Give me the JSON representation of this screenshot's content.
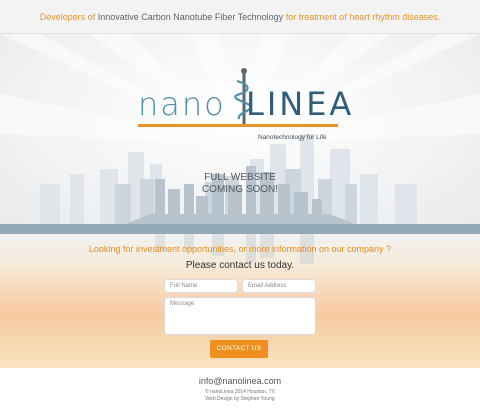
{
  "tagline": {
    "part1": "Developers of ",
    "part2": "Innovative Carbon Nanotube Fiber Technology",
    "part3": " for treatment of heart rhythm  diseases."
  },
  "logo": {
    "nano": "nano",
    "linea": "LINEA",
    "subtitle": "Nanotechnology for Life"
  },
  "hero": {
    "coming_line1": "FULL WEBSITE",
    "coming_line2": "COMING SOON!"
  },
  "contact": {
    "question": "Looking for  investment opportunities, or more information on our company ?",
    "prompt": "Please contact us today.",
    "full_name_placeholder": "Full Name",
    "email_placeholder": "Email Address",
    "message_placeholder": "Message",
    "button_label": "CONTACT US"
  },
  "footer": {
    "email": "info@nanolinea.com",
    "copyright": "© nanoLinea 2014 Houston, TX",
    "credit": "Web Design by Stephen Young"
  },
  "colors": {
    "accent_orange": "#e8932a",
    "brand_blue": "#2f5e79",
    "skyline": "#b7c4cd"
  }
}
